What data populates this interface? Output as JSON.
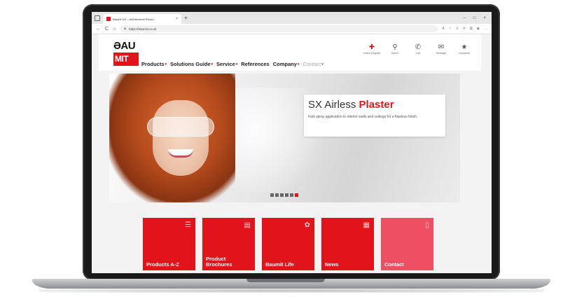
{
  "browser": {
    "tab_title": "Baumit UK – Architectural Renov...",
    "tab_close": "×",
    "new_tab": "+",
    "window_controls": [
      "–",
      "□",
      "×"
    ],
    "nav": {
      "back": "←",
      "refresh": "C",
      "home": "⌂"
    },
    "url": "https://baumit.co.uk",
    "extensions": [
      "A",
      "☆",
      "⚲",
      "⟳",
      "⧉",
      "◉",
      "…"
    ]
  },
  "site": {
    "logo": {
      "top": "ƏAU",
      "bottom": "MIT"
    },
    "nav": [
      {
        "label": "Products",
        "caret": "▾"
      },
      {
        "label": "Solutions Guide",
        "caret": "▾"
      },
      {
        "label": "Service",
        "caret": "▾"
      },
      {
        "label": "References",
        "caret": ""
      },
      {
        "label": "Company",
        "caret": "▾"
      },
      {
        "label": "Contact",
        "caret": "▾"
      }
    ],
    "tools": [
      {
        "icon": "target-icon",
        "glyph": "✚",
        "label": "United Kingdom"
      },
      {
        "icon": "search-icon",
        "glyph": "⚲",
        "label": "Search"
      },
      {
        "icon": "phone-icon",
        "glyph": "✆",
        "label": "Call"
      },
      {
        "icon": "mail-icon",
        "glyph": "✉",
        "label": "Message"
      },
      {
        "icon": "star-icon",
        "glyph": "★",
        "label": "mybaumit"
      }
    ]
  },
  "hero": {
    "title_prefix": "SX Airless ",
    "title_accent": "Plaster",
    "subtitle": "Fast spray application to interior walls and ceilings for a flawless finish.",
    "slides": 6,
    "active_slide": 6
  },
  "tiles": [
    {
      "label": "Products A-Z",
      "icon": "list-icon",
      "glyph": "☰"
    },
    {
      "label": "Product Brochures",
      "icon": "brochure-icon",
      "glyph": "▤"
    },
    {
      "label": "Baumit Life",
      "icon": "palette-icon",
      "glyph": "✿"
    },
    {
      "label": "News",
      "icon": "news-icon",
      "glyph": "▦"
    },
    {
      "label": "Contact",
      "icon": "mobile-icon",
      "glyph": "▯"
    }
  ],
  "colors": {
    "brand_red": "#e2141b",
    "tile_contact": "#ee4f63"
  }
}
